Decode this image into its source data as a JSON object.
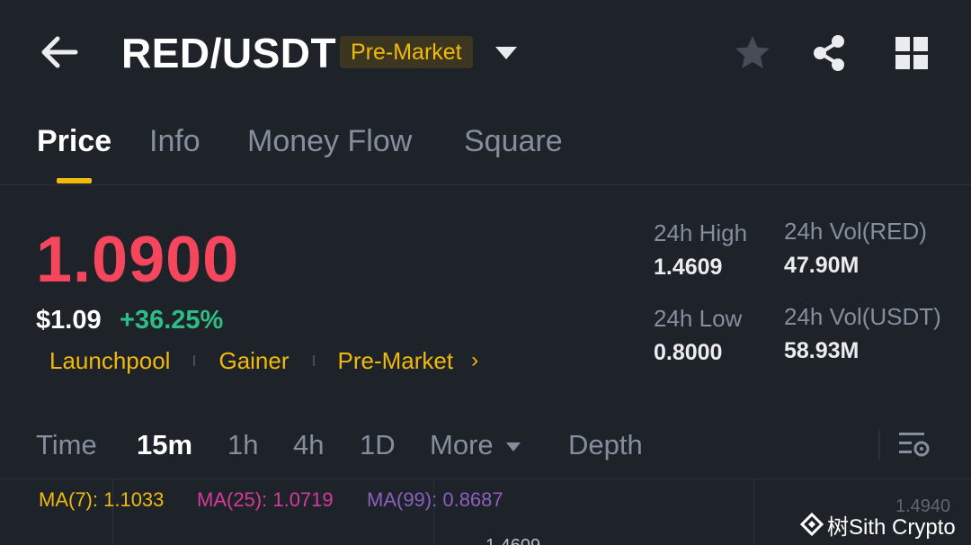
{
  "header": {
    "pair": "RED/USDT",
    "tag": "Pre-Market",
    "icons": [
      "arrow-left-icon",
      "caret-down-icon",
      "star-icon",
      "share-icon",
      "grid-icon"
    ]
  },
  "tabs": [
    {
      "label": "Price",
      "active": true
    },
    {
      "label": "Info",
      "active": false
    },
    {
      "label": "Money Flow",
      "active": false
    },
    {
      "label": "Square",
      "active": false
    }
  ],
  "price": {
    "last": "1.0900",
    "usd": "$1.09",
    "change": "+36.25%",
    "chips": [
      "Launchpool",
      "Gainer",
      "Pre-Market"
    ],
    "chip_arrow": "›"
  },
  "stats": {
    "high_label": "24h High",
    "high_value": "1.4609",
    "low_label": "24h Low",
    "low_value": "0.8000",
    "vol_base_label": "24h Vol(RED)",
    "vol_base_value": "47.90M",
    "vol_quote_label": "24h Vol(USDT)",
    "vol_quote_value": "58.93M"
  },
  "timeframes": {
    "items": [
      "Time",
      "15m",
      "1h",
      "4h",
      "1D",
      "More",
      "Depth"
    ],
    "active": "15m"
  },
  "indicators": {
    "ma7": "MA(7): 1.1033",
    "ma25": "MA(25): 1.0719",
    "ma99": "MA(99): 0.8687",
    "axis_top": "1.4940",
    "partial_label": "1.4609"
  },
  "watermark": "树Sith Crypto",
  "colors": {
    "background": "#1e2329",
    "accent": "#f0b90b",
    "down": "#f6465d",
    "up": "#2ebd85",
    "ma7": "#f0b90b",
    "ma25": "#d63b9a",
    "ma99": "#8b5fbf"
  }
}
